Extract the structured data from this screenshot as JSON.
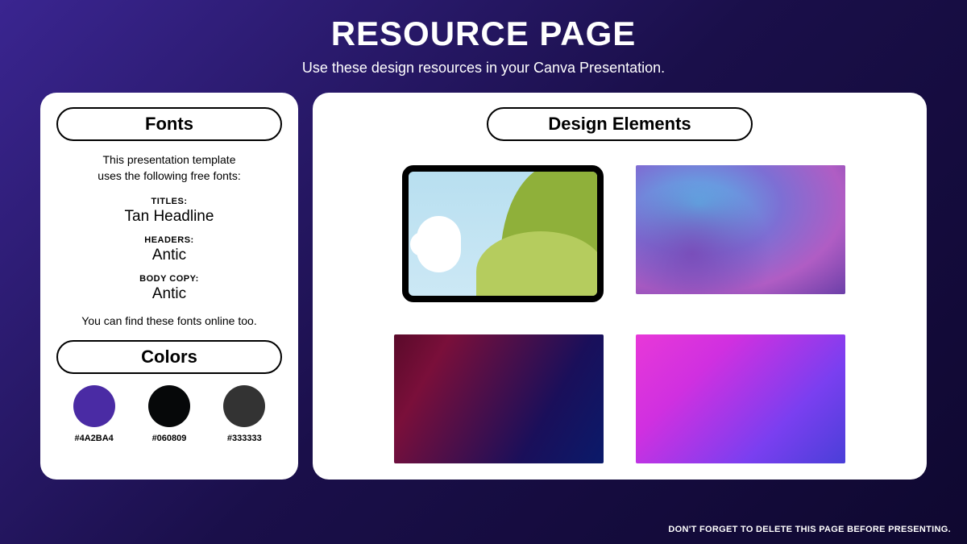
{
  "header": {
    "title": "RESOURCE PAGE",
    "subtitle": "Use these design resources in your Canva Presentation."
  },
  "fonts": {
    "heading": "Fonts",
    "desc_line1": "This presentation template",
    "desc_line2": "uses the following free fonts:",
    "titles_label": "TITLES:",
    "titles_value": "Tan Headline",
    "headers_label": "HEADERS:",
    "headers_value": "Antic",
    "body_label": "BODY COPY:",
    "body_value": "Antic",
    "note": "You can find these fonts online too."
  },
  "colors": {
    "heading": "Colors",
    "swatches": [
      {
        "hex": "#4A2BA4"
      },
      {
        "hex": "#060809"
      },
      {
        "hex": "#333333"
      }
    ]
  },
  "design": {
    "heading": "Design Elements"
  },
  "footer": "DON'T FORGET TO DELETE THIS PAGE BEFORE PRESENTING."
}
